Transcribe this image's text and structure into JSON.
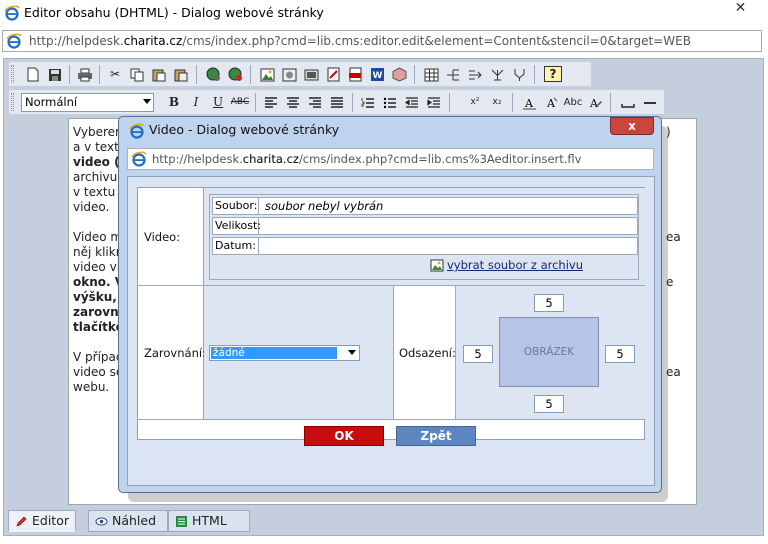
{
  "window": {
    "title": "Editor obsahu (DHTML) - Dialog webové stránky",
    "close_glyph": "✕",
    "url_prefix": "http://helpdesk.",
    "url_domain": "charita.cz",
    "url_suffix": "/cms/index.php?cmd=lib.cms:editor.edit&element=Content&stencil=0&target=WEB"
  },
  "toolbar": {
    "style_select_value": "Normální",
    "bold_label": "B",
    "italic_label": "I",
    "underline_label": "U",
    "strike_label": "ABC",
    "superscript_label": "x²",
    "subscript_label": "x₂",
    "font_abc_label": "Abc",
    "help_label": "?"
  },
  "editor_content": {
    "paragraph1_lines": [
      "Vyberem",
      "a v texto",
      "video (k",
      "archivu s",
      "v textu a",
      "video."
    ],
    "paragraph1_bold": {
      "texto": "texto",
      "video": "video"
    },
    "paragraph2_lines": [
      "Video m",
      "něj klikn",
      "video vlo",
      "okno. Vy",
      "výšku, š",
      "zarovná",
      "tlačítker"
    ],
    "paragraph3_lines": [
      "V případ",
      "video se",
      "webu."
    ],
    "right_fragments": [
      ")",
      "ea",
      "e",
      "ea"
    ]
  },
  "bottom_tabs": [
    {
      "label": "Editor",
      "icon": "pencil-icon"
    },
    {
      "label": "Náhled",
      "icon": "eye-icon"
    },
    {
      "label": "HTML",
      "icon": "html-icon"
    }
  ],
  "dialog": {
    "title": "Video - Dialog webové stránky",
    "close_glyph": "x",
    "url_prefix": "http://helpdesk.",
    "url_domain": "charita.cz",
    "url_suffix": "/cms/index.php?cmd=lib.cms%3Aeditor.insert.flv",
    "video_label": "Video:",
    "file_fields": [
      {
        "key": "Soubor:",
        "value": "soubor nebyl vybrán"
      },
      {
        "key": "Velikost:",
        "value": ""
      },
      {
        "key": "Datum:",
        "value": ""
      }
    ],
    "archive_link": "vybrat soubor z archivu",
    "align_label": "Zarovnání:",
    "align_value": "žádné",
    "offset_label": "Odsazení:",
    "offset_top": "5",
    "offset_left": "5",
    "offset_right": "5",
    "offset_bottom": "5",
    "preview_label": "OBRÁZEK",
    "ok_label": "OK",
    "back_label": "Zpět"
  }
}
